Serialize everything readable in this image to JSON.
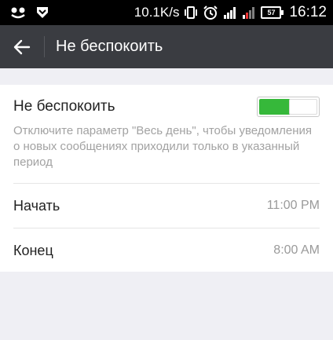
{
  "status_bar": {
    "icons_left": [
      "app-notification-icon",
      "shield-notification-icon"
    ],
    "net_speed": "10.1K/s",
    "icons_right": [
      "vibrate-icon",
      "alarm-icon",
      "signal-icon",
      "signal-icon",
      "battery-icon"
    ],
    "battery_level": "57",
    "time": "16:12"
  },
  "app_bar": {
    "back_icon": "arrow-left-icon",
    "title": "Не беспокоить"
  },
  "settings": {
    "dnd": {
      "label": "Не беспокоить",
      "enabled": true,
      "hint": "Отключите параметр \"Весь день\", чтобы уведомления о новых сообщениях приходили только в указанный период"
    },
    "start": {
      "label": "Начать",
      "value": "11:00 PM"
    },
    "end": {
      "label": "Конец",
      "value": "8:00 AM"
    }
  },
  "colors": {
    "status_bar": "#000000",
    "app_bar": "#3a3c41",
    "toggle_on": "#36b83a",
    "background": "#efeff4"
  }
}
